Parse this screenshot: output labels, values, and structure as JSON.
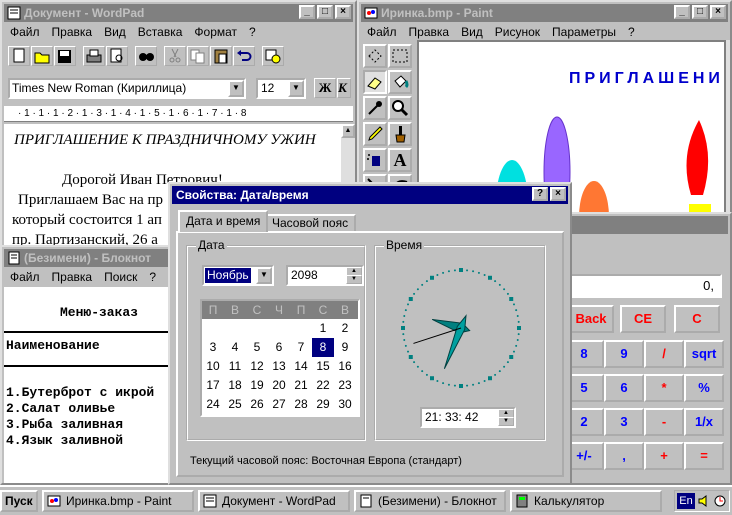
{
  "wordpad": {
    "title": "Документ - WordPad",
    "menu": [
      "Файл",
      "Правка",
      "Вид",
      "Вставка",
      "Формат",
      "?"
    ],
    "font": "Times New Roman (Кириллица)",
    "size": "12",
    "bold": "Ж",
    "italic": "К",
    "ruler": "· 1 · 1 · 1 · 2 · 1 · 3 · 1 · 4 · 1 · 5 · 1 · 6 · 1 · 7 · 1 · 8",
    "lines": [
      "ПРИГЛАШЕНИЕ К ПРАЗДНИЧНОМУ УЖИН",
      "Дорогой Иван Петрович!",
      "Приглашаем Вас на пр",
      "который состоится 1 ап",
      "пр. Партизанский, 26 а"
    ]
  },
  "paint": {
    "title": "Иринка.bmp - Paint",
    "menu": [
      "Файл",
      "Правка",
      "Вид",
      "Рисунок",
      "Параметры",
      "?"
    ],
    "canvas_text": "ПРИГЛАШЕНИ",
    "tool_letter": "A"
  },
  "notepad": {
    "title": "(Безимени) - Блокнот",
    "menu": [
      "Файл",
      "Правка",
      "Поиск",
      "?"
    ],
    "heading": "Меню-заказ",
    "column": "Наименование",
    "items": [
      "1.Бутерброт с икрой",
      "2.Салат оливье",
      "3.Рыба заливная",
      "4.Язык заливной"
    ]
  },
  "calc": {
    "display": "0,",
    "top": [
      "Back",
      "CE",
      "C"
    ],
    "rows": [
      [
        "8",
        "9",
        "/",
        "sqrt"
      ],
      [
        "5",
        "6",
        "*",
        "%"
      ],
      [
        "2",
        "3",
        "-",
        "1/x"
      ],
      [
        "+/-",
        ",",
        "+",
        "="
      ]
    ]
  },
  "dialog": {
    "title": "Свойства: Дата/время",
    "tabs": [
      "Дата и время",
      "Часовой пояс"
    ],
    "date_label": "Дата",
    "time_label": "Время",
    "month": "Ноябрь",
    "year": "2098",
    "weekdays": [
      "П",
      "В",
      "С",
      "Ч",
      "П",
      "С",
      "В"
    ],
    "weeks": [
      [
        "",
        "",
        "",
        "",
        "",
        "1",
        "2"
      ],
      [
        "3",
        "4",
        "5",
        "6",
        "7",
        "8",
        "9"
      ],
      [
        "10",
        "11",
        "12",
        "13",
        "14",
        "15",
        "16"
      ],
      [
        "17",
        "18",
        "19",
        "20",
        "21",
        "22",
        "23"
      ],
      [
        "24",
        "25",
        "26",
        "27",
        "28",
        "29",
        "30"
      ]
    ],
    "selected_day": "8",
    "time": "21: 33: 42",
    "timezone": "Текущий часовой пояс:  Восточная Европа (стандарт)"
  },
  "taskbar": {
    "start": "Пуск",
    "items": [
      "Иринка.bmp - Paint",
      "Документ - WordPad",
      "(Безимени) - Блокнот",
      "Калькулятор"
    ],
    "lang": "En"
  },
  "colors": {
    "title_active": "#000080",
    "title_inactive": "#808080",
    "face": "#c0c0c0",
    "desktop": "#008080"
  }
}
